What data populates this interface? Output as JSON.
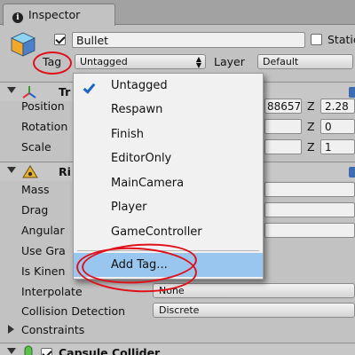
{
  "window": {
    "tab_title": "Inspector"
  },
  "gameobject": {
    "active": true,
    "name": "Bullet",
    "static_label": "Static",
    "tag_label": "Tag",
    "tag_value": "Untagged",
    "layer_label": "Layer",
    "layer_value": "Default"
  },
  "transform": {
    "title_fragment": "Tr",
    "position_label": "Position",
    "position_y_partial": "88657",
    "position_z": "2.28",
    "rotation_label": "Rotation",
    "rotation_z": "0",
    "scale_label": "Scale",
    "scale_z": "1",
    "z_label": "Z"
  },
  "rigidbody": {
    "title_fragment": "Ri",
    "mass_label": "Mass",
    "drag_label": "Drag",
    "angular_label": "Angular",
    "use_gravity_label": "Use Gra",
    "is_kinematic_label": "Is Kinen",
    "interpolate_label": "Interpolate",
    "interpolate_value": "None",
    "collision_detection_label": "Collision Detection",
    "collision_detection_value": "Discrete",
    "constraints_label": "Constraints"
  },
  "capsule_collider": {
    "title": "Capsule Collider"
  },
  "tag_menu": {
    "items": [
      {
        "label": "Untagged",
        "checked": true
      },
      {
        "label": "Respawn"
      },
      {
        "label": "Finish"
      },
      {
        "label": "EditorOnly"
      },
      {
        "label": "MainCamera"
      },
      {
        "label": "Player"
      },
      {
        "label": "GameController"
      }
    ],
    "add_tag_label": "Add Tag..."
  },
  "colors": {
    "highlight": "#98c6ef",
    "annotation": "#e0101a",
    "check": "#1d63c8"
  }
}
